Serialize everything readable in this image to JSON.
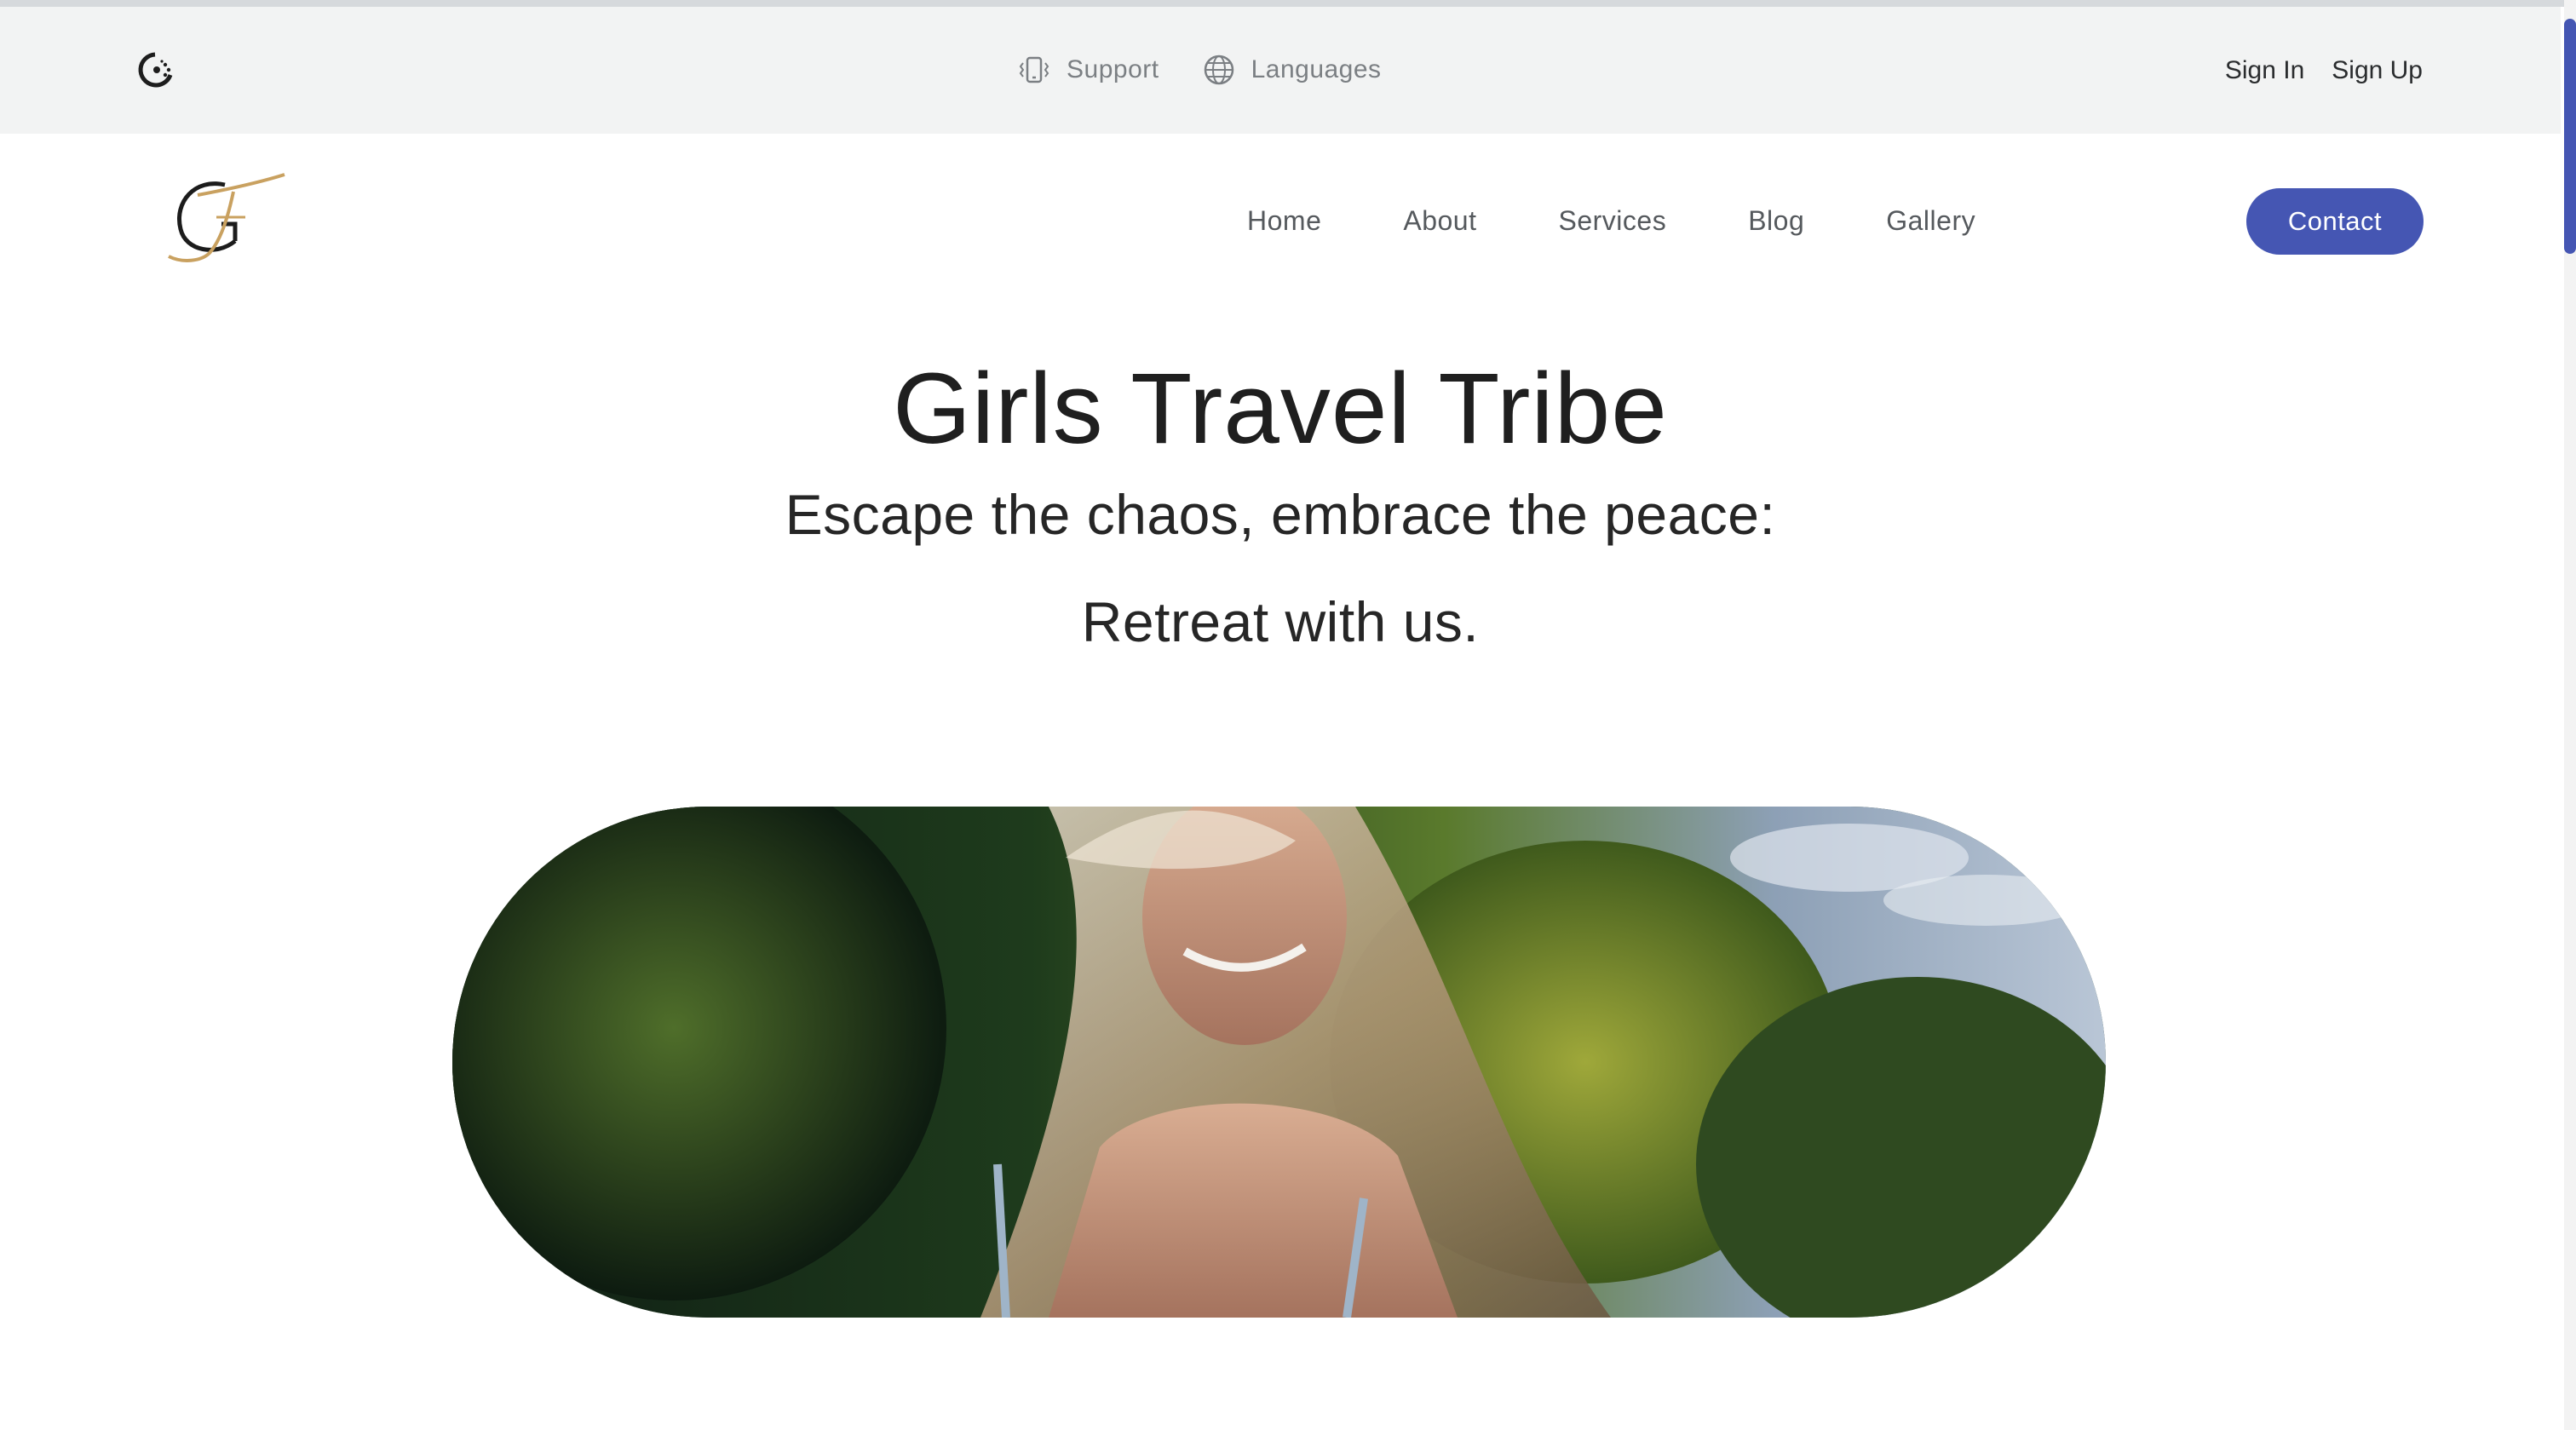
{
  "topbar": {
    "brand_icon": "circle-dots-logo-icon",
    "support_label": "Support",
    "support_icon": "phone-vibrate-icon",
    "languages_label": "Languages",
    "languages_icon": "globe-icon",
    "sign_in": "Sign In",
    "sign_up": "Sign Up"
  },
  "nav": {
    "logo_icon": "gt-monogram-logo",
    "items": [
      "Home",
      "About",
      "Services",
      "Blog",
      "Gallery"
    ],
    "contact_label": "Contact"
  },
  "hero": {
    "title": "Girls Travel Tribe",
    "subtitle_line1": "Escape the chaos, embrace the peace:",
    "subtitle_line2": "Retreat with us."
  },
  "colors": {
    "accent": "#4556b3",
    "topbar_bg": "#f2f3f3",
    "logo_gold": "#c9a160"
  }
}
